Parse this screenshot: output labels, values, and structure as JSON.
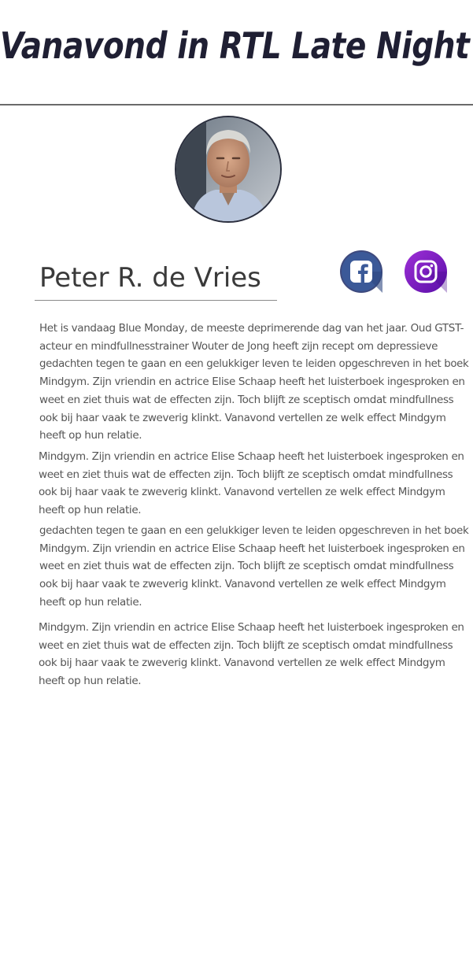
{
  "header": {
    "title": "Vanavond in RTL Late Night"
  },
  "profile": {
    "name": "Peter R. de Vries",
    "avatar_alt": "Peter R. de Vries"
  },
  "social": {
    "facebook_icon": "facebook-icon",
    "instagram_icon": "instagram-icon",
    "facebook_color": "#3b5998",
    "instagram_color": "#7b1fc0"
  },
  "article": {
    "paragraphs": [
      {
        "lines": [
          "Het is vandaag Blue Monday, de meeste deprimerende dag van het jaar. Oud GTST-",
          "acteur en mindfullnesstrainer Wouter de Jong heeft zijn recept om depressieve",
          "gedachten tegen te gaan en een gelukkiger leven te leiden opgeschreven in het boek",
          "Mindgym. Zijn vriendin en actrice Elise Schaap heeft het luisterboek ingesproken en",
          "weet en ziet thuis wat de effecten zijn. Toch blijft ze sceptisch omdat mindfullness",
          "ook bij haar vaak te zweverig klinkt. Vanavond vertellen ze welk effect Mindgym",
          "heeft op hun relatie."
        ]
      },
      {
        "lines": [
          "Mindgym. Zijn vriendin en actrice Elise Schaap heeft het luisterboek ingesproken en",
          "weet en ziet thuis wat de effecten zijn. Toch blijft ze sceptisch omdat mindfullness",
          "ook bij haar vaak te zweverig klinkt. Vanavond vertellen ze welk effect Mindgym",
          "heeft op hun relatie."
        ]
      },
      {
        "lines": [
          "gedachten tegen te gaan en een gelukkiger leven te leiden opgeschreven in het boek",
          "Mindgym. Zijn vriendin en actrice Elise Schaap heeft het luisterboek ingesproken en",
          "weet en ziet thuis wat de effecten zijn. Toch blijft ze sceptisch omdat mindfullness",
          "ook bij haar vaak te zweverig klinkt. Vanavond vertellen ze welk effect Mindgym",
          "heeft op hun relatie."
        ]
      },
      {
        "lines": [
          "Mindgym. Zijn vriendin en actrice Elise Schaap heeft het luisterboek ingesproken en",
          "weet en ziet thuis wat de effecten zijn. Toch blijft ze sceptisch omdat mindfullness",
          "ook bij haar vaak te zweverig klinkt. Vanavond vertellen ze welk effect Mindgym",
          "heeft op hun relatie."
        ]
      }
    ]
  }
}
